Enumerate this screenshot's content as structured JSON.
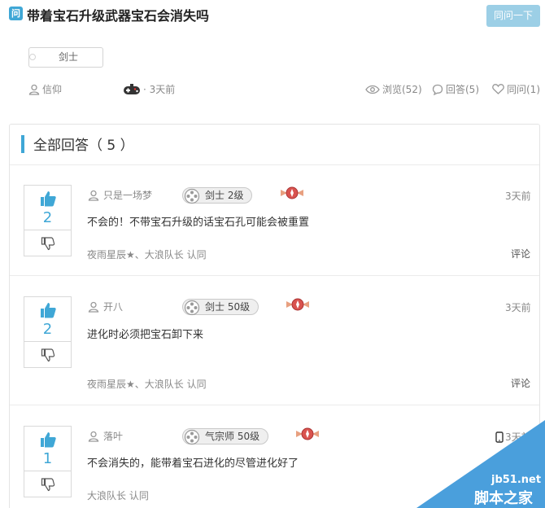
{
  "question": {
    "badge": "问",
    "title": "带着宝石升级武器宝石会消失吗",
    "same_button": "同问一下",
    "tag": "剑士",
    "author": "信仰",
    "time": "· 3天前",
    "views": "浏览(52)",
    "answers": "回答(5)",
    "same_count": "同问(1)"
  },
  "answers_header": {
    "title": "全部回答（ 5 ）"
  },
  "answers": [
    {
      "votes": "2",
      "user": "只是一场梦",
      "level": "剑士 2级",
      "time": "3天前",
      "text": "不会的！不带宝石升级的话宝石孔可能会被重置",
      "approved": "夜雨星辰★、大浪队长 认同",
      "comment": "评论"
    },
    {
      "votes": "2",
      "user": "开八",
      "level": "剑士 50级",
      "time": "3天前",
      "text": "进化时必须把宝石卸下来",
      "approved": "夜雨星辰★、大浪队长 认同",
      "comment": "评论"
    },
    {
      "votes": "1",
      "user": "落叶",
      "level": "气宗师 50级",
      "time": "3天前",
      "text": "不会消失的，能带着宝石进化的尽管进化好了",
      "approved": "大浪队长 认同",
      "comment": ""
    }
  ],
  "watermark": {
    "site": "jb51.net",
    "name": "脚本之家",
    "color": "#4a9fdc"
  },
  "colors": {
    "accent": "#3fa7d6",
    "button": "#9ccfe6"
  },
  "icons": [
    "person-icon",
    "gamepad-icon",
    "eye-icon",
    "chat-bubble-icon",
    "heart-icon",
    "thumb-up-icon",
    "thumb-down-icon",
    "gamepad-disc-icon",
    "rank-emblem-icon",
    "mobile-phone-icon"
  ]
}
